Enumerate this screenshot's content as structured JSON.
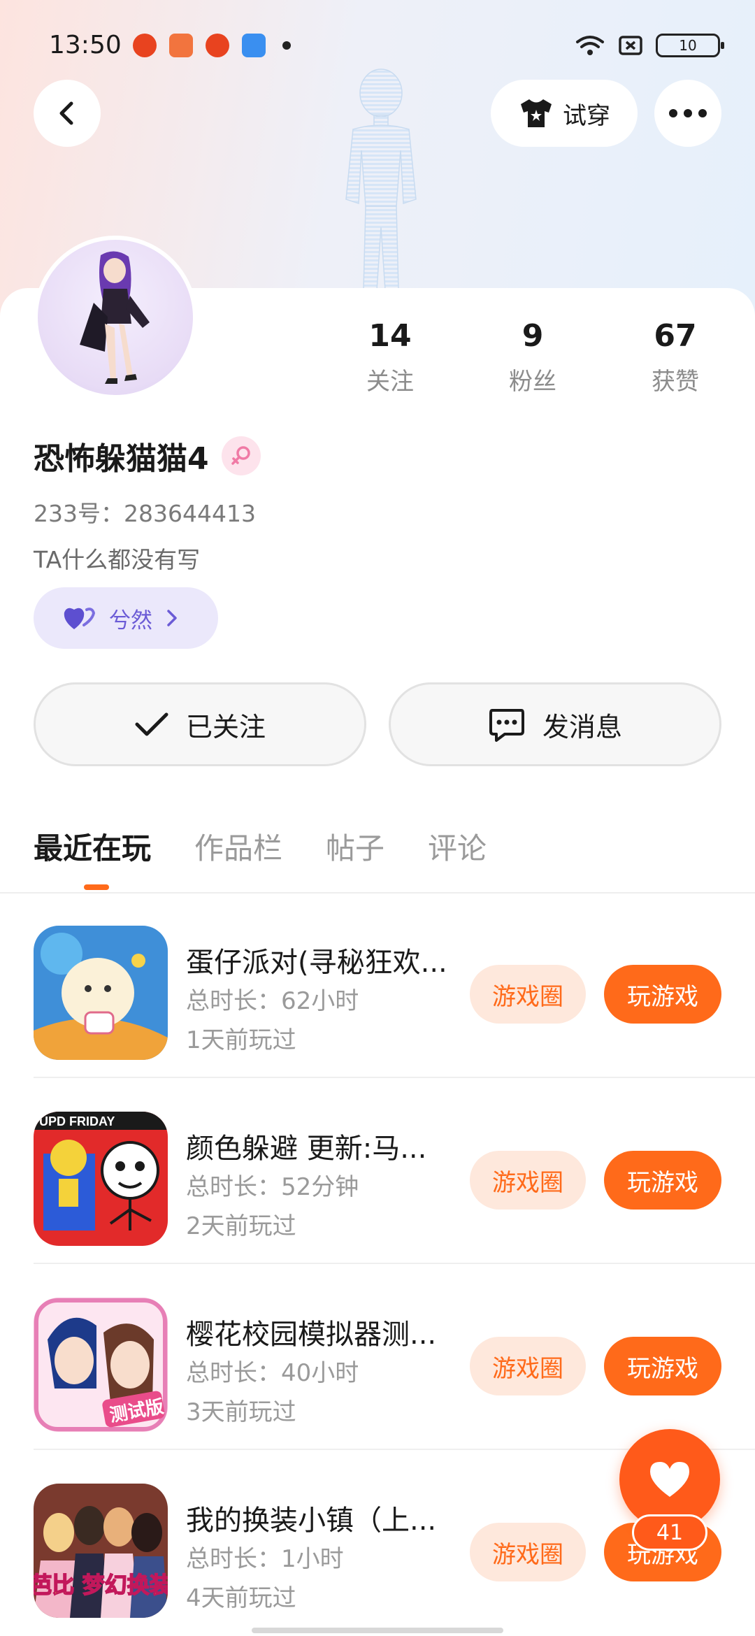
{
  "status_bar": {
    "time": "13:50",
    "battery": "10",
    "app_colors": [
      "#e8431f",
      "#f2743e",
      "#e8431f",
      "#3a8ff0"
    ]
  },
  "header": {
    "try_on_label": "试穿"
  },
  "profile": {
    "nickname": "恐怖躲猫猫4",
    "user_id": "233号：283644413",
    "bio": "TA什么都没有写",
    "tag_label": "兮然",
    "stats": [
      {
        "value": "14",
        "label": "关注"
      },
      {
        "value": "9",
        "label": "粉丝"
      },
      {
        "value": "67",
        "label": "获赞"
      }
    ]
  },
  "actions": {
    "follow_label": "已关注",
    "message_label": "发消息"
  },
  "tabs": [
    {
      "label": "最近在玩",
      "active": true
    },
    {
      "label": "作品栏",
      "active": false
    },
    {
      "label": "帖子",
      "active": false
    },
    {
      "label": "评论",
      "active": false
    }
  ],
  "games": [
    {
      "title": "蛋仔派对(寻秘狂欢...",
      "duration": "总时长：62小时",
      "last_played": "1天前玩过",
      "circle_label": "游戏圈",
      "play_label": "玩游戏",
      "icon": "eggy-party-icon"
    },
    {
      "title": "颜色躲避 更新:马...",
      "duration": "总时长：52分钟",
      "last_played": "2天前玩过",
      "circle_label": "游戏圈",
      "play_label": "玩游戏",
      "icon": "color-dodge-icon",
      "icon_text": "UPD FRIDAY"
    },
    {
      "title": "樱花校园模拟器测...",
      "duration": "总时长：40小时",
      "last_played": "3天前玩过",
      "circle_label": "游戏圈",
      "play_label": "玩游戏",
      "icon": "sakura-school-icon",
      "icon_text": "测试版"
    },
    {
      "title": "我的换装小镇（上...",
      "duration": "总时长：1小时",
      "last_played": "4天前玩过",
      "circle_label": "游戏圈",
      "play_label": "玩游戏",
      "icon": "dress-up-town-icon",
      "icon_text": "芭比 梦幻换装"
    }
  ],
  "fab": {
    "count": "41"
  },
  "colors": {
    "accent": "#ff6a1a",
    "accent_soft": "#fee8dc",
    "tag_purple": "#6b5bd6"
  }
}
